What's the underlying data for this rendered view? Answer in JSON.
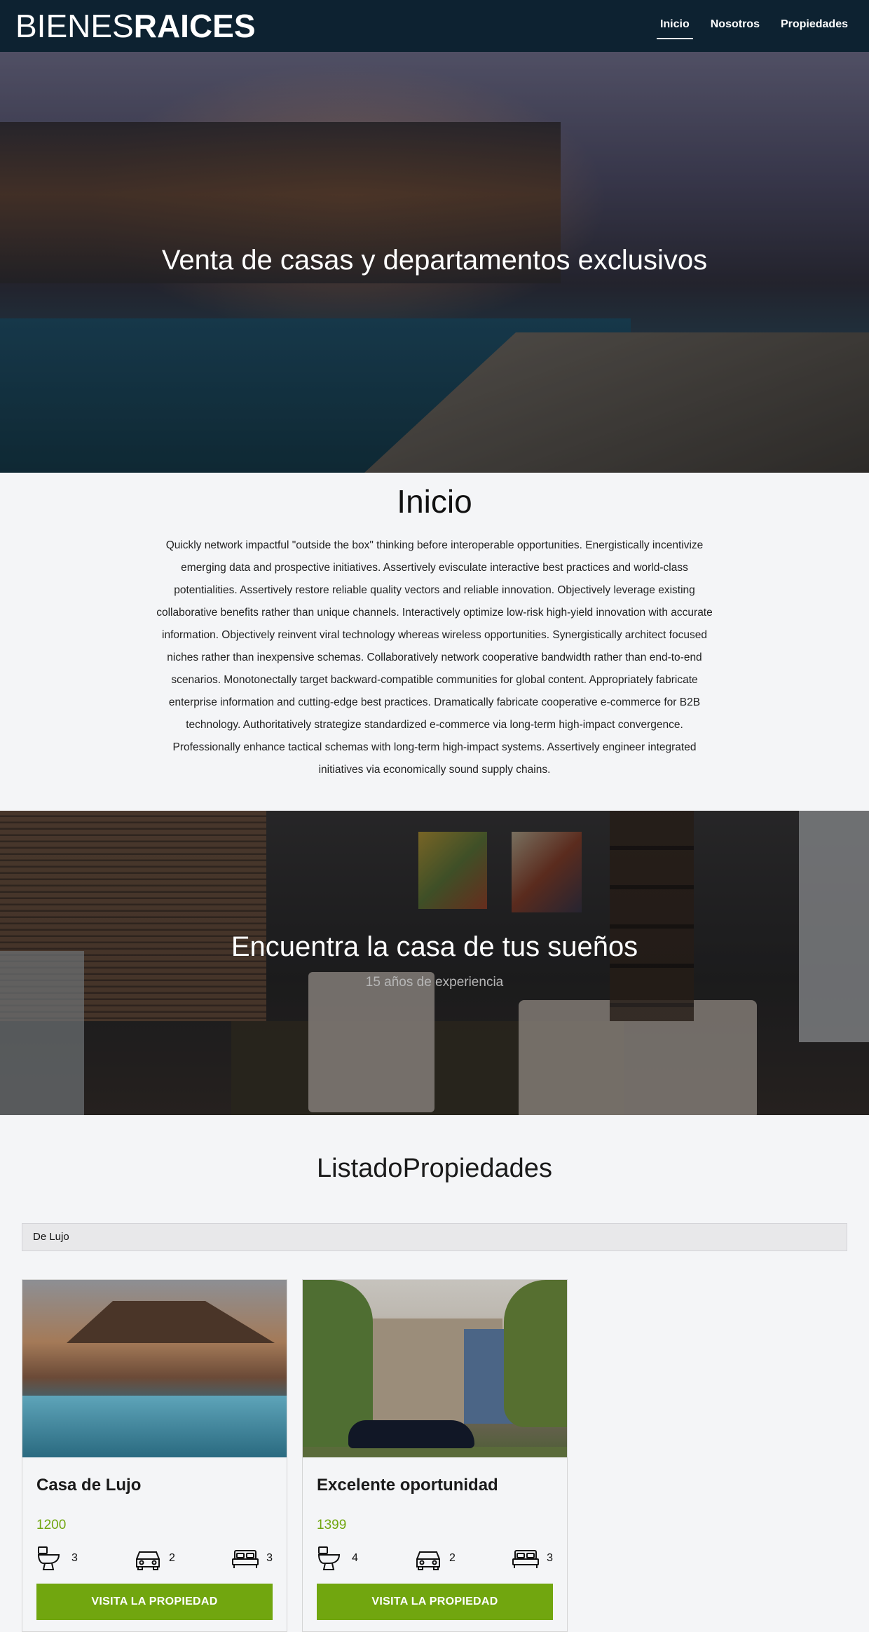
{
  "header": {
    "logo_light": "BIENES",
    "logo_bold": "RAICES",
    "nav": [
      {
        "label": "Inicio",
        "active": true
      },
      {
        "label": "Nosotros",
        "active": false
      },
      {
        "label": "Propiedades",
        "active": false
      }
    ]
  },
  "hero": {
    "title": "Venta de casas y departamentos exclusivos"
  },
  "inicio": {
    "heading": "Inicio",
    "body": "Quickly network impactful \"outside the box\" thinking before interoperable opportunities. Energistically incentivize emerging data and prospective initiatives. Assertively evisculate interactive best practices and world-class potentialities. Assertively restore reliable quality vectors and reliable innovation. Objectively leverage existing collaborative benefits rather than unique channels. Interactively optimize low-risk high-yield innovation with accurate information. Objectively reinvent viral technology whereas wireless opportunities. Synergistically architect focused niches rather than inexpensive schemas. Collaboratively network cooperative bandwidth rather than end-to-end scenarios. Monotonectally target backward-compatible communities for global content. Appropriately fabricate enterprise information and cutting-edge best practices. Dramatically fabricate cooperative e-commerce for B2B technology. Authoritatively strategize standardized e-commerce via long-term high-impact convergence. Professionally enhance tactical schemas with long-term high-impact systems. Assertively engineer integrated initiatives via economically sound supply chains."
  },
  "banner": {
    "title": "Encuentra la casa de tus sueños",
    "subtitle": "15 años de experiencia"
  },
  "listado": {
    "title": "ListadoPropiedades",
    "filter_value": "De Lujo",
    "properties": [
      {
        "title": "Casa de Lujo",
        "price": "1200",
        "bathrooms": "3",
        "parking": "2",
        "bedrooms": "3",
        "button": "VISITA LA PROPIEDAD"
      },
      {
        "title": "Excelente oportunidad",
        "price": "1399",
        "bathrooms": "4",
        "parking": "2",
        "bedrooms": "3",
        "button": "VISITA LA PROPIEDAD"
      }
    ]
  },
  "colors": {
    "header_bg": "#0d2231",
    "accent_green": "#71a60f",
    "page_bg": "#f4f5f7"
  },
  "icons": [
    "toilet-icon",
    "car-icon",
    "bed-icon"
  ]
}
